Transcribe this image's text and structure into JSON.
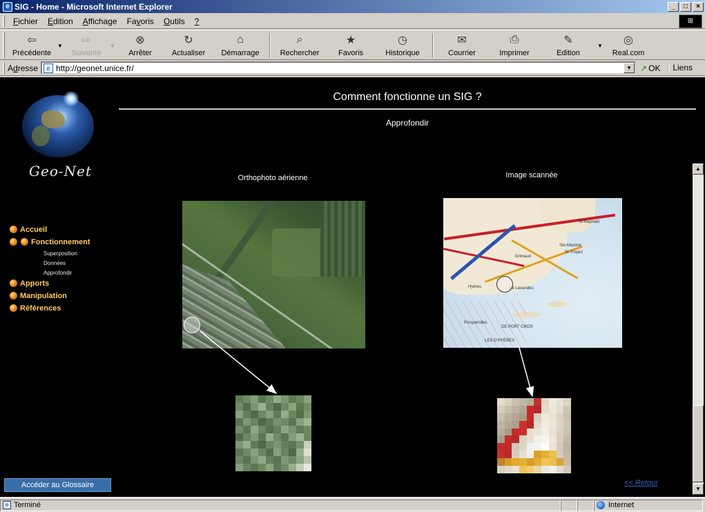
{
  "window": {
    "title": "SIG - Home - Microsoft Internet Explorer",
    "buttons": {
      "minimize": "_",
      "maximize": "□",
      "close": "×"
    }
  },
  "menu": {
    "items": [
      {
        "pre": "",
        "key": "F",
        "post": "ichier"
      },
      {
        "pre": "",
        "key": "E",
        "post": "dition"
      },
      {
        "pre": "",
        "key": "A",
        "post": "ffichage"
      },
      {
        "pre": "Fa",
        "key": "v",
        "post": "oris"
      },
      {
        "pre": "",
        "key": "O",
        "post": "utils"
      },
      {
        "pre": "",
        "key": "?",
        "post": ""
      }
    ]
  },
  "toolbar": {
    "buttons": [
      {
        "label": "Précédente",
        "icon": "back-arrow-icon",
        "enabled": true
      },
      {
        "label": "Suivante",
        "icon": "forward-arrow-icon",
        "enabled": false
      },
      {
        "label": "Arrêter",
        "icon": "stop-icon",
        "enabled": true
      },
      {
        "label": "Actualiser",
        "icon": "refresh-icon",
        "enabled": true
      },
      {
        "label": "Démarrage",
        "icon": "home-icon",
        "enabled": true
      },
      {
        "label": "Rechercher",
        "icon": "search-icon",
        "enabled": true
      },
      {
        "label": "Favoris",
        "icon": "favorites-icon",
        "enabled": true
      },
      {
        "label": "Historique",
        "icon": "history-icon",
        "enabled": true
      },
      {
        "label": "Courrier",
        "icon": "mail-icon",
        "enabled": true
      },
      {
        "label": "Imprimer",
        "icon": "print-icon",
        "enabled": true
      },
      {
        "label": "Edition",
        "icon": "edit-icon",
        "enabled": true
      },
      {
        "label": "Real.com",
        "icon": "real-icon",
        "enabled": true
      }
    ]
  },
  "address": {
    "label_pre": "A",
    "label_key": "d",
    "label_post": "resse",
    "url": "http://geonet.unice.fr/",
    "go_label": "OK",
    "links_label": "Liens"
  },
  "page": {
    "logo_text": "Geo-Net",
    "title": "Comment fonctionne un SIG ?",
    "subtitle": "Approfondir",
    "nav": {
      "items": [
        {
          "label": "Accueil",
          "active": false
        },
        {
          "label": "Fonctionnement",
          "active": true,
          "sub": [
            "Superposition",
            "Données",
            "Approfondir"
          ]
        },
        {
          "label": "Apports",
          "active": false
        },
        {
          "label": "Manipulation",
          "active": false
        },
        {
          "label": "Références",
          "active": false
        }
      ]
    },
    "ortho_caption": "Orthophoto aérienne",
    "scan_caption": "Image scannée",
    "map_labels": [
      "St-Raphaël",
      "Ste-Maxime",
      "St-Tropez",
      "Hyères",
      "Le Lavandou",
      "Grimaud",
      "DE PORT CROS",
      "Porquerolles",
      "LES D'HYÈRES"
    ],
    "glossary_button": "Accéder au Glossaire",
    "back_link": "<< Retour"
  },
  "status": {
    "text": "Terminé",
    "zone": "Internet"
  },
  "colors": {
    "nav_label": "#ffcc66",
    "page_bg": "#000000",
    "titlebar_start": "#0a246a",
    "glossary_bg": "#3a6ea8"
  },
  "pixel_grids": {
    "ortho": [
      "#5d7d55",
      "#6e8c63",
      "#829e76",
      "#5a7752",
      "#6d8b62",
      "#93ac86",
      "#7b9870",
      "#5e7b55",
      "#6a875f",
      "#8aa47d",
      "#6f8b65",
      "#537049",
      "#7b976f",
      "#9ab58c",
      "#668360",
      "#4e6c46",
      "#6d8a63",
      "#8ba57e",
      "#5b7851",
      "#708d66",
      "#88a37d",
      "#63805a",
      "#4f6c47",
      "#6b8762",
      "#86a17a",
      "#5f7c57",
      "#93ad87",
      "#6a865f",
      "#51704a",
      "#7c9872",
      "#5a7650",
      "#7d996f",
      "#6a8660",
      "#4c6a44",
      "#5d7b55",
      "#78946e",
      "#6e8a64",
      "#587551",
      "#86a07c",
      "#9cb791",
      "#71906a",
      "#5b7853",
      "#8fa984",
      "#6b8762",
      "#557249",
      "#65825d",
      "#8da87f",
      "#7a966f",
      "#5e7b56",
      "#6b8863",
      "#4f6d48",
      "#6c8962",
      "#7f9b74",
      "#5c7953",
      "#92ac88",
      "#6e8b66",
      "#5a7752",
      "#829e77",
      "#9ab38f",
      "#6a865f",
      "#7e9a73",
      "#93ad88",
      "#5f7c56",
      "#4d6b46",
      "#6a8660",
      "#7b976f",
      "#61805b",
      "#5a7751",
      "#739069",
      "#c8d0b8",
      "#5b7852",
      "#6f8b66",
      "#88a47e",
      "#6b8762",
      "#506e49",
      "#85a07a",
      "#6a8661",
      "#4f6c47",
      "#95ae8a",
      "#dde2cc",
      "#6c8863",
      "#567450",
      "#7a966f",
      "#91ab87",
      "#64815c",
      "#587550",
      "#7e9a73",
      "#6b8863",
      "#8ba57f",
      "#b9c4a8",
      "#879f7b",
      "#6a8660",
      "#5b7853",
      "#6e8a65",
      "#8aa47e",
      "#5d7a55",
      "#6f8c67",
      "#97b08c",
      "#c5cdb5",
      "#e6e8d8"
    ],
    "scan": [
      "#e4dccd",
      "#d9d0bd",
      "#c9bfaa",
      "#bfb7a6",
      "#b7ad9a",
      "#c1342c",
      "#e2d6c4",
      "#efe8dc",
      "#e9e2d6",
      "#dcd4c4",
      "#d6cdbb",
      "#c8bda8",
      "#bfb3a0",
      "#b1a794",
      "#c82a26",
      "#b8262a",
      "#e5dbcb",
      "#ede6da",
      "#e3dbcc",
      "#cfc6b5",
      "#c9c0ae",
      "#bcb19e",
      "#b1a692",
      "#a89c89",
      "#c52b28",
      "#d8cfbf",
      "#efe9dc",
      "#e8e1d3",
      "#dad1c0",
      "#c9c0ae",
      "#bfb5a2",
      "#b3a995",
      "#aa9f8b",
      "#cf2f2c",
      "#b82727",
      "#e2dacb",
      "#f1ece1",
      "#ece5d9",
      "#ddd5c5",
      "#cec5b3",
      "#b6ac98",
      "#a89d8a",
      "#c42c29",
      "#c9302e",
      "#e8dfcf",
      "#ebe5d9",
      "#f4efe6",
      "#e7e1d5",
      "#d9d1c0",
      "#cac1af",
      "#a99e8a",
      "#c22c2a",
      "#b8282a",
      "#dad2c2",
      "#e6dfd2",
      "#f3efe7",
      "#f8f5ef",
      "#ede7dc",
      "#d7cfbf",
      "#c2b9a7",
      "#be2d2b",
      "#c12a29",
      "#d1c8b7",
      "#ddd5c6",
      "#ecf0f4",
      "#f5f3ee",
      "#ffffff",
      "#e9e3d8",
      "#d2cab9",
      "#bdb4a2",
      "#c4302c",
      "#b92828",
      "#d6ceb8",
      "#e7e0d2",
      "#f2eee6",
      "#d9a32a",
      "#e5b02e",
      "#ecc04a",
      "#d4cbb9",
      "#c3b9a7",
      "#c3822a",
      "#d49a2a",
      "#e4a82c",
      "#e6b038",
      "#d89c28",
      "#e4ad32",
      "#f0c45a",
      "#ebbf55",
      "#d8a53a",
      "#cdb8a0",
      "#d8cfbf",
      "#e0d8c9",
      "#e8e1d4",
      "#f0c25a",
      "#f4ce6c",
      "#e8d6b0",
      "#eee8dd",
      "#f5f1ea",
      "#e3dccf",
      "#d2c9b8"
    ]
  }
}
